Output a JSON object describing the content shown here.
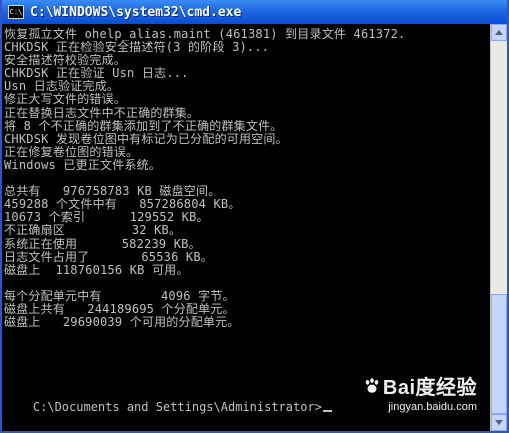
{
  "window": {
    "title": "C:\\WINDOWS\\system32\\cmd.exe",
    "icon_text": "C:\\"
  },
  "console": {
    "lines": [
      "恢复孤立文件 ohelp_alias.maint (461381) 到目录文件 461372.",
      "CHKDSK 正在检验安全描述符(3 的阶段 3)...",
      "安全描述符校验完成。",
      "CHKDSK 正在验证 Usn 日志...",
      "Usn 日志验证完成。",
      "修正大写文件的错误。",
      "正在替换日志文件中不正确的群集。",
      "将 8 个不正确的群集添加到了不正确的群集文件。",
      "CHKDSK 发现卷位图中有标记为已分配的可用空间。",
      "正在修复卷位图的错误。",
      "Windows 已更正文件系统。",
      "",
      "总共有   976758783 KB 磁盘空间。",
      "459288 个文件中有   857286804 KB。",
      "10673 个索引      129552 KB。",
      "不正确扇区         32 KB。",
      "系统正在使用      582239 KB。",
      "日志文件占用了       65536 KB。",
      "磁盘上  118760156 KB 可用。",
      "",
      "每个分配单元中有        4096 字节。",
      "磁盘上共有   244189695 个分配单元。",
      "磁盘上   29690039 个可用的分配单元。"
    ],
    "prompt": "C:\\Documents and Settings\\Administrator>"
  },
  "scrollbar": {
    "up_icon": "arrow-up-icon",
    "down_icon": "arrow-down-icon"
  },
  "watermark": {
    "brand": "Bai度经验",
    "url": "jingyan.baidu.com"
  },
  "colors": {
    "titlebar": "#0a4ed2",
    "console_text": "#c0c0c0",
    "console_bg": "#000000"
  }
}
